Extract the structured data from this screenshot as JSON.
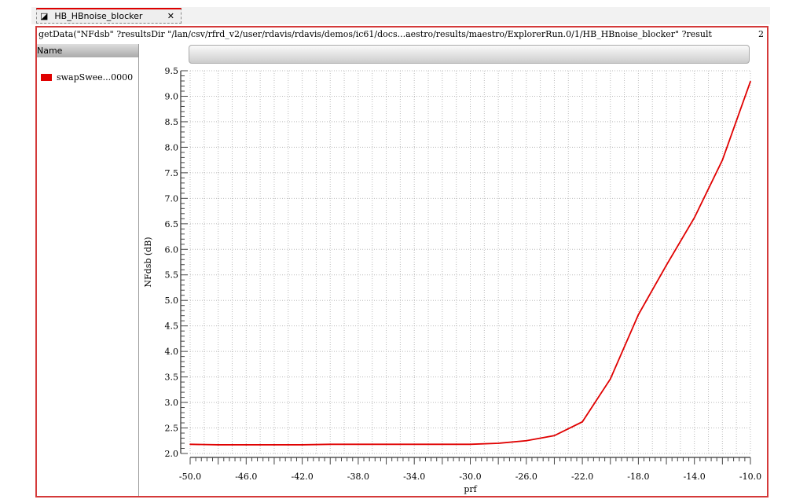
{
  "tab": {
    "title": "HB_HBnoise_blocker",
    "close": "✕"
  },
  "expression": "getData(\"NFdsb\" ?resultsDir \"/lan/csv/rfrd_v2/user/rdavis/rdavis/demos/ic61/docs...aestro/results/maestro/ExplorerRun.0/1/HB_HBnoise_blocker\" ?result",
  "subwindow_number": "2",
  "sidebar": {
    "header": "Name",
    "items": [
      {
        "label": "swapSwee...0000",
        "color": "#e00000"
      }
    ]
  },
  "chart_data": {
    "type": "line",
    "title": "",
    "xlabel": "prf",
    "ylabel": "NFdsb (dB)",
    "xlim": [
      -50,
      -10
    ],
    "ylim": [
      2.0,
      9.5
    ],
    "grid": true,
    "xticks": [
      "-50.0",
      "-46.0",
      "-42.0",
      "-38.0",
      "-34.0",
      "-30.0",
      "-26.0",
      "-22.0",
      "-18.0",
      "-14.0",
      "-10.0"
    ],
    "yticks": [
      "2.0",
      "2.5",
      "3.0",
      "3.5",
      "4.0",
      "4.5",
      "5.0",
      "5.5",
      "6.0",
      "6.5",
      "7.0",
      "7.5",
      "8.0",
      "8.5",
      "9.0",
      "9.5"
    ],
    "series": [
      {
        "name": "swapSwee...0000",
        "color": "#e00000",
        "x": [
          -50,
          -48,
          -46,
          -44,
          -42,
          -40,
          -38,
          -36,
          -34,
          -32,
          -30,
          -28,
          -26,
          -24,
          -22,
          -20,
          -18,
          -16,
          -14,
          -12,
          -10
        ],
        "y": [
          2.18,
          2.17,
          2.17,
          2.17,
          2.17,
          2.18,
          2.18,
          2.18,
          2.18,
          2.18,
          2.18,
          2.2,
          2.25,
          2.35,
          2.62,
          3.46,
          4.72,
          5.69,
          6.62,
          7.75,
          9.29
        ]
      }
    ]
  }
}
